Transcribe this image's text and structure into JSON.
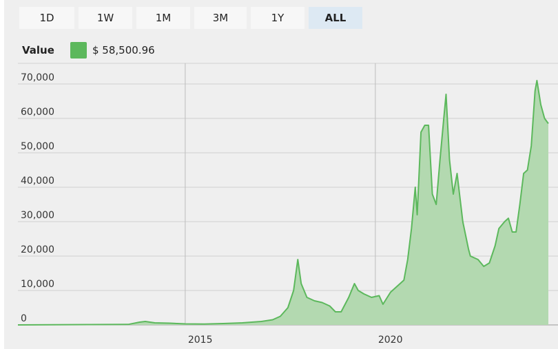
{
  "range_buttons": [
    {
      "label": "1D",
      "active": false
    },
    {
      "label": "1W",
      "active": false
    },
    {
      "label": "1M",
      "active": false
    },
    {
      "label": "3M",
      "active": false
    },
    {
      "label": "1Y",
      "active": false
    },
    {
      "label": "ALL",
      "active": true
    }
  ],
  "legend": {
    "label": "Value",
    "value": "$ 58,500.96",
    "color": "#5cb85c"
  },
  "chart_data": {
    "type": "area",
    "title": "",
    "xlabel": "",
    "ylabel": "",
    "xlim": [
      2010.6,
      2024.55
    ],
    "ylim": [
      0,
      76000
    ],
    "y_ticks": [
      0,
      10000,
      20000,
      30000,
      40000,
      50000,
      60000,
      70000
    ],
    "y_tick_labels": [
      "0",
      "10,000",
      "20,000",
      "30,000",
      "40,000",
      "50,000",
      "60,000",
      "70,000"
    ],
    "x_ticks": [
      2015,
      2020
    ],
    "x_tick_labels": [
      "2015",
      "2020"
    ],
    "grid": true,
    "line_color": "#5cb85c",
    "fill_color": "#b3d9b0",
    "series": [
      {
        "x": [
          2010.6,
          2011.5,
          2012.5,
          2013.5,
          2013.8,
          2013.95,
          2014.2,
          2014.6,
          2015.0,
          2015.5,
          2016.0,
          2016.5,
          2017.0,
          2017.3,
          2017.5,
          2017.7,
          2017.85,
          2017.96,
          2018.05,
          2018.2,
          2018.4,
          2018.6,
          2018.8,
          2018.95,
          2019.1,
          2019.3,
          2019.45,
          2019.55,
          2019.7,
          2019.9,
          2020.1,
          2020.2,
          2020.4,
          2020.6,
          2020.75,
          2020.85,
          2020.95,
          2021.05,
          2021.1,
          2021.2,
          2021.3,
          2021.4,
          2021.5,
          2021.6,
          2021.7,
          2021.8,
          2021.86,
          2021.95,
          2022.05,
          2022.15,
          2022.3,
          2022.45,
          2022.5,
          2022.7,
          2022.85,
          2023.0,
          2023.15,
          2023.25,
          2023.4,
          2023.5,
          2023.6,
          2023.7,
          2023.8,
          2023.9,
          2024.0,
          2024.1,
          2024.2,
          2024.25,
          2024.35,
          2024.45,
          2024.55
        ],
        "y": [
          0,
          50,
          100,
          150,
          800,
          1000,
          600,
          500,
          300,
          250,
          400,
          600,
          1000,
          1500,
          2500,
          5000,
          10000,
          19000,
          12000,
          8000,
          7000,
          6500,
          5500,
          3800,
          3800,
          8000,
          12000,
          10000,
          9000,
          8000,
          8500,
          6000,
          9500,
          11500,
          13000,
          19000,
          28000,
          40000,
          32000,
          56000,
          58000,
          58000,
          38000,
          35000,
          48000,
          60000,
          67000,
          48000,
          38000,
          44000,
          30000,
          22000,
          20000,
          19000,
          17000,
          18000,
          23000,
          28000,
          30000,
          31000,
          27000,
          27000,
          35000,
          44000,
          45000,
          52000,
          68000,
          71000,
          64000,
          60000,
          58500
        ]
      }
    ]
  }
}
